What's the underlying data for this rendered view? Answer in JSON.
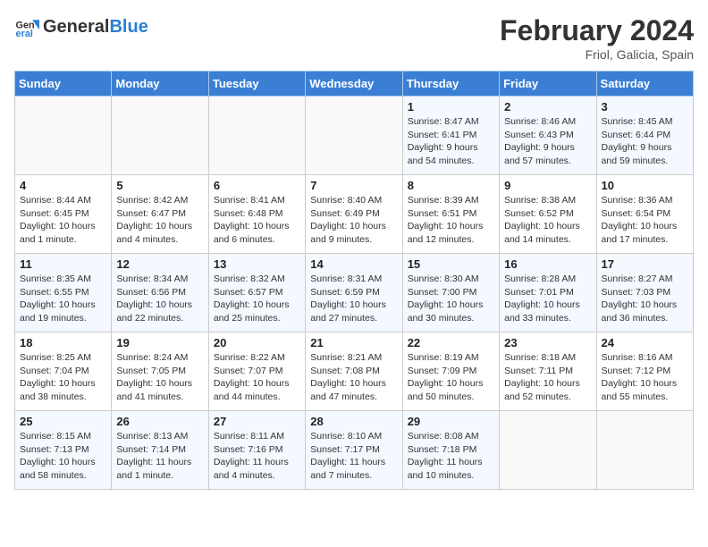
{
  "logo": {
    "text_general": "General",
    "text_blue": "Blue"
  },
  "header": {
    "month": "February 2024",
    "location": "Friol, Galicia, Spain"
  },
  "weekdays": [
    "Sunday",
    "Monday",
    "Tuesday",
    "Wednesday",
    "Thursday",
    "Friday",
    "Saturday"
  ],
  "weeks": [
    [
      {
        "day": "",
        "info": ""
      },
      {
        "day": "",
        "info": ""
      },
      {
        "day": "",
        "info": ""
      },
      {
        "day": "",
        "info": ""
      },
      {
        "day": "1",
        "info": "Sunrise: 8:47 AM\nSunset: 6:41 PM\nDaylight: 9 hours\nand 54 minutes."
      },
      {
        "day": "2",
        "info": "Sunrise: 8:46 AM\nSunset: 6:43 PM\nDaylight: 9 hours\nand 57 minutes."
      },
      {
        "day": "3",
        "info": "Sunrise: 8:45 AM\nSunset: 6:44 PM\nDaylight: 9 hours\nand 59 minutes."
      }
    ],
    [
      {
        "day": "4",
        "info": "Sunrise: 8:44 AM\nSunset: 6:45 PM\nDaylight: 10 hours\nand 1 minute."
      },
      {
        "day": "5",
        "info": "Sunrise: 8:42 AM\nSunset: 6:47 PM\nDaylight: 10 hours\nand 4 minutes."
      },
      {
        "day": "6",
        "info": "Sunrise: 8:41 AM\nSunset: 6:48 PM\nDaylight: 10 hours\nand 6 minutes."
      },
      {
        "day": "7",
        "info": "Sunrise: 8:40 AM\nSunset: 6:49 PM\nDaylight: 10 hours\nand 9 minutes."
      },
      {
        "day": "8",
        "info": "Sunrise: 8:39 AM\nSunset: 6:51 PM\nDaylight: 10 hours\nand 12 minutes."
      },
      {
        "day": "9",
        "info": "Sunrise: 8:38 AM\nSunset: 6:52 PM\nDaylight: 10 hours\nand 14 minutes."
      },
      {
        "day": "10",
        "info": "Sunrise: 8:36 AM\nSunset: 6:54 PM\nDaylight: 10 hours\nand 17 minutes."
      }
    ],
    [
      {
        "day": "11",
        "info": "Sunrise: 8:35 AM\nSunset: 6:55 PM\nDaylight: 10 hours\nand 19 minutes."
      },
      {
        "day": "12",
        "info": "Sunrise: 8:34 AM\nSunset: 6:56 PM\nDaylight: 10 hours\nand 22 minutes."
      },
      {
        "day": "13",
        "info": "Sunrise: 8:32 AM\nSunset: 6:57 PM\nDaylight: 10 hours\nand 25 minutes."
      },
      {
        "day": "14",
        "info": "Sunrise: 8:31 AM\nSunset: 6:59 PM\nDaylight: 10 hours\nand 27 minutes."
      },
      {
        "day": "15",
        "info": "Sunrise: 8:30 AM\nSunset: 7:00 PM\nDaylight: 10 hours\nand 30 minutes."
      },
      {
        "day": "16",
        "info": "Sunrise: 8:28 AM\nSunset: 7:01 PM\nDaylight: 10 hours\nand 33 minutes."
      },
      {
        "day": "17",
        "info": "Sunrise: 8:27 AM\nSunset: 7:03 PM\nDaylight: 10 hours\nand 36 minutes."
      }
    ],
    [
      {
        "day": "18",
        "info": "Sunrise: 8:25 AM\nSunset: 7:04 PM\nDaylight: 10 hours\nand 38 minutes."
      },
      {
        "day": "19",
        "info": "Sunrise: 8:24 AM\nSunset: 7:05 PM\nDaylight: 10 hours\nand 41 minutes."
      },
      {
        "day": "20",
        "info": "Sunrise: 8:22 AM\nSunset: 7:07 PM\nDaylight: 10 hours\nand 44 minutes."
      },
      {
        "day": "21",
        "info": "Sunrise: 8:21 AM\nSunset: 7:08 PM\nDaylight: 10 hours\nand 47 minutes."
      },
      {
        "day": "22",
        "info": "Sunrise: 8:19 AM\nSunset: 7:09 PM\nDaylight: 10 hours\nand 50 minutes."
      },
      {
        "day": "23",
        "info": "Sunrise: 8:18 AM\nSunset: 7:11 PM\nDaylight: 10 hours\nand 52 minutes."
      },
      {
        "day": "24",
        "info": "Sunrise: 8:16 AM\nSunset: 7:12 PM\nDaylight: 10 hours\nand 55 minutes."
      }
    ],
    [
      {
        "day": "25",
        "info": "Sunrise: 8:15 AM\nSunset: 7:13 PM\nDaylight: 10 hours\nand 58 minutes."
      },
      {
        "day": "26",
        "info": "Sunrise: 8:13 AM\nSunset: 7:14 PM\nDaylight: 11 hours\nand 1 minute."
      },
      {
        "day": "27",
        "info": "Sunrise: 8:11 AM\nSunset: 7:16 PM\nDaylight: 11 hours\nand 4 minutes."
      },
      {
        "day": "28",
        "info": "Sunrise: 8:10 AM\nSunset: 7:17 PM\nDaylight: 11 hours\nand 7 minutes."
      },
      {
        "day": "29",
        "info": "Sunrise: 8:08 AM\nSunset: 7:18 PM\nDaylight: 11 hours\nand 10 minutes."
      },
      {
        "day": "",
        "info": ""
      },
      {
        "day": "",
        "info": ""
      }
    ]
  ]
}
